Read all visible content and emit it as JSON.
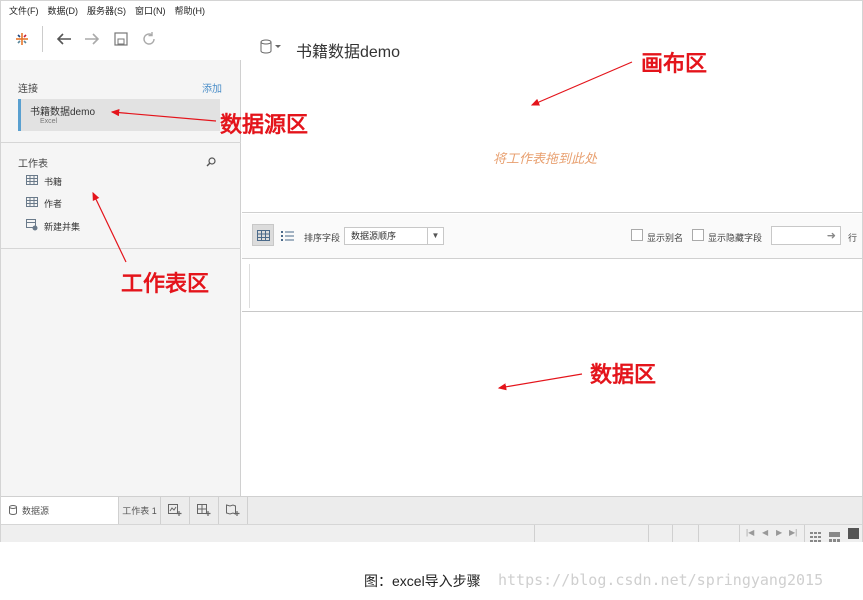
{
  "menu": [
    "文件(F)",
    "数据(D)",
    "服务器(S)",
    "窗口(N)",
    "帮助(H)"
  ],
  "sidebar": {
    "connections_label": "连接",
    "add_label": "添加",
    "connection": {
      "name": "书籍数据demo",
      "type": "Excel"
    },
    "sheets_label": "工作表",
    "sheets": [
      {
        "label": "书籍",
        "icon": "table-icon"
      },
      {
        "label": "作者",
        "icon": "table-icon"
      },
      {
        "label": "新建并集",
        "icon": "new-union-icon"
      }
    ]
  },
  "canvas": {
    "title": "书籍数据demo",
    "drop_hint": "将工作表拖到此处"
  },
  "gridbar": {
    "sort_label": "排序字段",
    "sort_value": "数据源顺序",
    "show_alias_label": "显示别名",
    "show_hidden_label": "显示隐藏字段",
    "rows_label": "行"
  },
  "tabs": {
    "datasource_label": "数据源",
    "sheet1_label": "工作表 1"
  },
  "annotations": {
    "canvas_area": "画布区",
    "datasource_area": "数据源区",
    "sheet_area": "工作表区",
    "data_area": "数据区"
  },
  "caption": "图：excel导入步骤",
  "watermark": "https://blog.csdn.net/springyang2015",
  "colors": {
    "annotation": "#e4141b",
    "link": "#4b8ec8",
    "drop_hint": "#e8a070",
    "connection_accent": "#5aa0d0"
  }
}
